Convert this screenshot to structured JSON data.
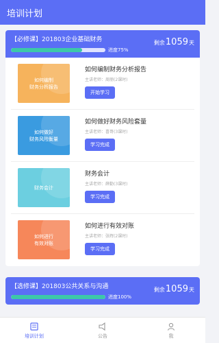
{
  "header": {
    "title": "培训计划"
  },
  "plans": [
    {
      "title": "【必修课】201803企业基础财务",
      "remain_prefix": "剩余",
      "remain_num": "1059",
      "remain_unit": "天",
      "progress_label": "进度75%",
      "progress": 0.75,
      "courses": [
        {
          "title": "如何编制财务分析报告",
          "teacher": "主讲老师：周丽(2课时)",
          "button": "开始学习",
          "thumb_text": "如何编制\n财务分析报告",
          "thumb_color": "#f6b35c"
        },
        {
          "title": "如何做好财务风险套量",
          "teacher": "主讲老师：喜哥(3课时)",
          "button": "学习完成",
          "thumb_text": "如何做好\n财务风险衡量",
          "thumb_color": "#3a9be0"
        },
        {
          "title": "财务会计",
          "teacher": "主讲老师：薛勤(3课时)",
          "button": "学习完成",
          "thumb_text": "财务会计",
          "thumb_color": "#6ccfe0"
        },
        {
          "title": "如何进行有效对账",
          "teacher": "主讲老师：张辉(2课时)",
          "button": "学习完成",
          "thumb_text": "如何进行\n有效对账",
          "thumb_color": "#f6875a"
        }
      ]
    },
    {
      "title": "【选修课】201803公共关系与沟通",
      "remain_prefix": "剩余",
      "remain_num": "1059",
      "remain_unit": "天",
      "progress_label": "进度100%",
      "progress": 1.0
    }
  ],
  "tabbar": [
    {
      "label": "培训计划",
      "icon": "training-plan-icon",
      "active": true
    },
    {
      "label": "公告",
      "icon": "announcement-icon",
      "active": false
    },
    {
      "label": "我",
      "icon": "user-icon",
      "active": false
    }
  ],
  "colors": {
    "primary": "#5b6ef5",
    "progress": "#3cc8a8"
  }
}
